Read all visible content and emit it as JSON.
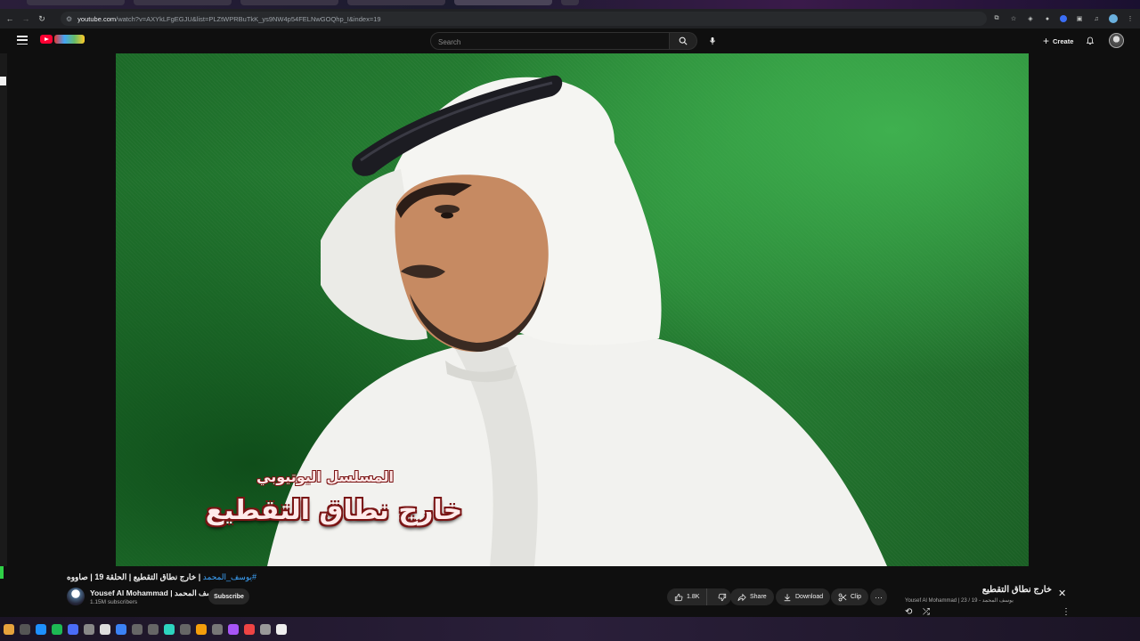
{
  "browser": {
    "url_host": "youtube.com",
    "url_rest": "/watch?v=AXYkLFgEGJU&list=PLZtWPRBuTkK_ys9NW4p54FELNwGOQhp_I&index=19",
    "nav_back": "←",
    "nav_forward": "→",
    "nav_reload": "↻"
  },
  "masthead": {
    "search_placeholder": "Search",
    "create_label": "Create"
  },
  "video": {
    "overlay_subtitle": "المسلسل اليوتيوبي",
    "overlay_title": "خارج نطاق التقطيع"
  },
  "info": {
    "title_hashtag": "#يوسف_المحمد",
    "title_text": "| خارج نطاق التقطيع | الحلقة 19 | صاووه",
    "channel_name": "Yousef Al Mohammad | يوسف المحمد",
    "subscribers": "1.15M subscribers",
    "subscribe_label": "Subscribe",
    "likes": "1.8K",
    "share_label": "Share",
    "download_label": "Download",
    "clip_label": "Clip",
    "more_label": "···"
  },
  "playlist": {
    "title": "خارج نطاق التقطيع",
    "meta": "Yousef Al Mohammad | يوسف المحمد - 19 / 23",
    "close": "✕",
    "loop": "⟲",
    "shuffle": "⤮",
    "more": "⋮"
  },
  "colors": {
    "brand_red": "#ff0033",
    "link_blue": "#3ea6ff",
    "page_bg": "#0f0f0f"
  }
}
